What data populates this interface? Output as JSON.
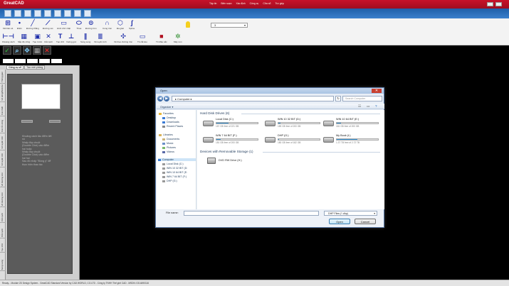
{
  "app": {
    "title": "GreatCAD",
    "menus": [
      "Tập tin",
      "Biên soạn",
      "Xác định",
      "Công cụ",
      "Cửa sổ",
      "Trợ giúp"
    ]
  },
  "ribbon": {
    "row1": [
      "Kết bản vẽ",
      "Điểm",
      "Đường thẳng",
      "Đường nét",
      "Hình chữ nhật",
      "Thoa",
      "Đường tròn",
      "Cung tròn",
      "Đa giác",
      "Spline"
    ],
    "row2": [
      "Khoảng cách",
      "Sắp độ vững",
      "Tạo trước",
      "Cắt cạnh",
      "Tạo chữ",
      "Vuông góc",
      "Song song",
      "Vẽ tuyến tính",
      "Vẽ theo đường tròn",
      "Tô cắt kéo",
      "Tô Màu sắc",
      "Mây nén"
    ],
    "layer_value": "3"
  },
  "left_panel": {
    "tabs": [
      "Công cụ vẽ",
      "Tạo mới phông"
    ],
    "vertical_tabs": [
      "Thông gian",
      "Vẽ dòng/Stickmo",
      "Các thiết",
      "Các lỗi vững",
      "Vẽ tuyến tính",
      "Vẽ tuyến tính",
      "Vẽ đường tròn",
      "Vẽ đường tròn",
      "Cắt cạnh",
      "Cắt cạnh",
      "Tạo chữ",
      "Song song"
    ],
    "hint": "Khoảng cách tâu điểm tiết\nnó\n   Nhấp đúp chuột\n(Double Click) vào điểm\nhai hoặc\n   Nhấp đúp chuột\n(Double Click) vào điểm\nhai hai\nSau đó nhấp \"Đồng ý\" để\nthực hiện thao tác"
  },
  "status_bar": "Ready... Module 2D Design System - GreatCAD Standard Version by CAD WORLD, CO.LTD - Công ty TNHH Thế giới CAD - MSDN: 0314490116",
  "dialog": {
    "title": "Open",
    "address": "▸ Computer ▸",
    "search_placeholder": "Search Computer",
    "organize": "Organize ▾",
    "nav": {
      "favorites": "Favorites",
      "desktop": "Desktop",
      "downloads": "Downloads",
      "recent": "Recent Places",
      "libraries": "Libraries",
      "documents": "Documents",
      "music": "Music",
      "pictures": "Pictures",
      "videos": "Videos",
      "computer": "Computer",
      "localdisk": "Local Disk (C:)",
      "win32": "WIN 10 32 BIT (D:",
      "win64": "WIN 10 64 BIT (E:",
      "win7": "WIN 7 64 BIT (F:)",
      "dhp": "DHP (G:)"
    },
    "group_hdd": "Hard Disk Drives (6)",
    "group_removable": "Devices with Removable Storage (1)",
    "drives": [
      {
        "name": "Local Disk (C:)",
        "free": "157 GB free of 221 GB",
        "fill": 0.29
      },
      {
        "name": "WIN 10 32 BIT (D:)",
        "free": "189 GB free of 200 GB",
        "fill": 0.06
      },
      {
        "name": "WIN 10 64 BIT (E:)",
        "free": "181 GB free of 200 GB",
        "fill": 0.1
      },
      {
        "name": "WIN 7 64 BIT (F:)",
        "free": "181 GB free of 200 GB",
        "fill": 0.1
      },
      {
        "name": "DHP (G:)",
        "free": "180 GB free of 182 GB",
        "fill": 0.01
      },
      {
        "name": "My Book (I:)",
        "free": "1.37 TB free of 2.72 TB",
        "fill": 0.5
      }
    ],
    "dvd": "DVD RW Drive (H:)",
    "filename_label": "File name:",
    "filetype": "DHP Files (*.dhp)",
    "open_label": "Open",
    "cancel_label": "Cancel"
  }
}
